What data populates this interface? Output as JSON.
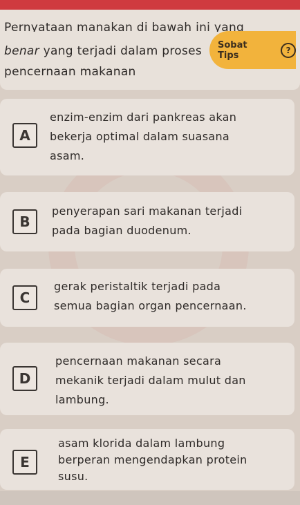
{
  "question": {
    "line1": "Pernyataan manakan di bawah ini yang",
    "line2_italic": "benar",
    "line2_rest": " yang terjadi dalam proses",
    "line3": "pencernaan makanan"
  },
  "tips": {
    "label": "Sobat Tips",
    "icon": "question-circle-icon",
    "color": "#f2b33c"
  },
  "options": [
    {
      "letter": "A",
      "lines": [
        "enzim-enzim dari pankreas akan",
        "bekerja optimal dalam suasana",
        "asam."
      ]
    },
    {
      "letter": "B",
      "lines": [
        "penyerapan sari makanan terjadi",
        "pada bagian duodenum."
      ]
    },
    {
      "letter": "C",
      "lines": [
        "gerak peristaltik terjadi pada",
        "semua bagian organ pencernaan."
      ]
    },
    {
      "letter": "D",
      "lines": [
        "pencernaan makanan secara",
        "mekanik terjadi dalam mulut dan",
        "lambung."
      ]
    },
    {
      "letter": "E",
      "lines": [
        "asam klorida dalam lambung",
        "berperan mengendapkan protein",
        "susu."
      ]
    }
  ],
  "colors": {
    "accent_red": "#cf3a3f",
    "card": "#e9e2dc"
  }
}
